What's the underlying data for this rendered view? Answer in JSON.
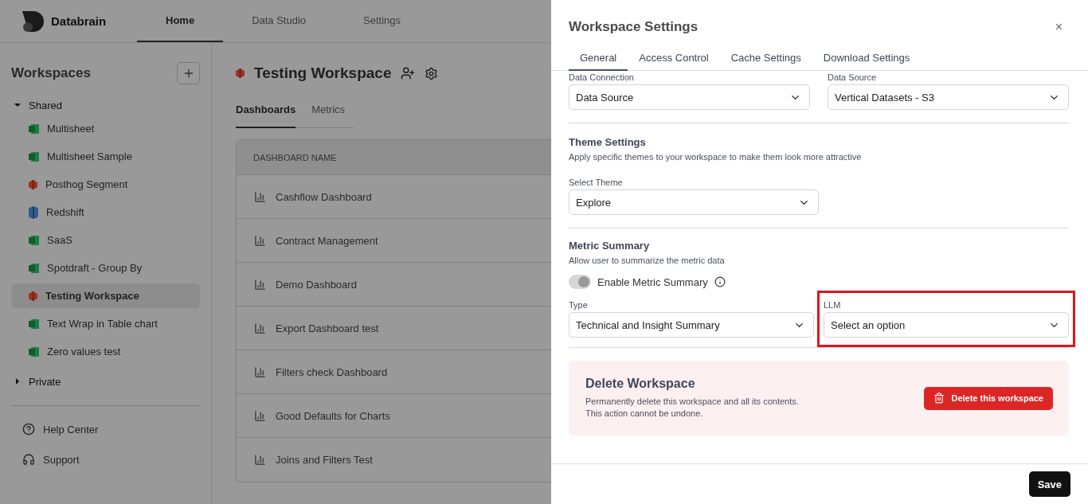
{
  "app": {
    "brand": "Databrain",
    "nav": [
      {
        "label": "Home",
        "selected": true
      },
      {
        "label": "Data Studio",
        "selected": false
      },
      {
        "label": "Settings",
        "selected": false
      }
    ],
    "sidebar": {
      "title": "Workspaces",
      "groups": [
        {
          "label": "Shared",
          "expanded": true,
          "children": [
            {
              "label": "Multisheet",
              "kind": "sheet",
              "selected": false
            },
            {
              "label": "Multisheet Sample",
              "kind": "sheet",
              "selected": false
            },
            {
              "label": "Posthog Segment",
              "kind": "posthog",
              "selected": false
            },
            {
              "label": "Redshift",
              "kind": "redshift",
              "selected": false
            },
            {
              "label": "SaaS",
              "kind": "sheet",
              "selected": false
            },
            {
              "label": "Spotdraft - Group By",
              "kind": "sheet",
              "selected": false
            },
            {
              "label": "Testing Workspace",
              "kind": "posthog",
              "selected": true
            },
            {
              "label": "Text Wrap in Table chart",
              "kind": "sheet",
              "selected": false
            },
            {
              "label": "Zero values test",
              "kind": "sheet",
              "selected": false
            }
          ]
        },
        {
          "label": "Private",
          "expanded": false
        }
      ],
      "footer": [
        {
          "label": "Help Center",
          "kind": "help"
        },
        {
          "label": "Support",
          "kind": "support"
        }
      ]
    },
    "workspace": {
      "title": "Testing Workspace",
      "tabs": [
        {
          "label": "Dashboards",
          "selected": true
        },
        {
          "label": "Metrics",
          "selected": false
        }
      ],
      "table": {
        "columns": [
          "DASHBOARD NAME"
        ],
        "rows": [
          "Cashflow Dashboard",
          "Contract Management",
          "Demo Dashboard",
          "Export Dashboard test",
          "Filters check Dashboard",
          "Good Defaults for Charts",
          "Joins and Filters Test"
        ]
      }
    }
  },
  "drawer": {
    "title": "Workspace Settings",
    "close": "×",
    "tabs": [
      {
        "label": "General",
        "selected": true
      },
      {
        "label": "Access Control",
        "selected": false
      },
      {
        "label": "Cache Settings",
        "selected": false
      },
      {
        "label": "Download Settings",
        "selected": false
      }
    ],
    "connection": [
      {
        "label": "Data Connection",
        "value": "Data Source"
      },
      {
        "label": "Data Source",
        "value": "Vertical Datasets - S3"
      }
    ],
    "theme": {
      "title": "Theme Settings",
      "description": "Apply specific themes to your workspace to make them look more attractive",
      "label": "Select Theme",
      "value": "Explore"
    },
    "metric_summary": {
      "title": "Metric Summary",
      "description": "Allow user to summarize the metric data",
      "toggle": {
        "label": "Enable Metric Summary",
        "on": true,
        "disabled": true
      },
      "fields": [
        {
          "label": "Type",
          "value": "Technical and Insight Summary",
          "highlighted": false
        },
        {
          "label": "LLM",
          "placeholder": "Select an option",
          "highlighted": true
        }
      ]
    },
    "danger": {
      "title": "Delete Workspace",
      "description": [
        "Permanently delete this workspace and all its contents.",
        "This action cannot be undone."
      ],
      "button": "Delete this workspace"
    },
    "save": "Save"
  }
}
